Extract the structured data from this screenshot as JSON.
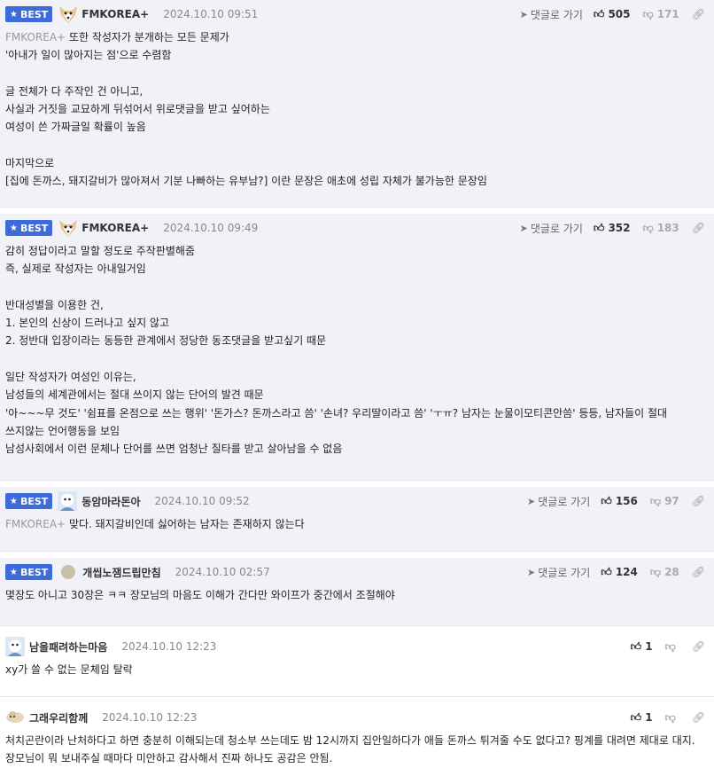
{
  "ui": {
    "reply_label": "댓글로 가기",
    "best_label": "BEST",
    "accent": "#3d6bd7"
  },
  "comments": [
    {
      "nick": "FMKOREA+",
      "date": "2024.10.10 09:51",
      "up": "505",
      "down": "171",
      "lines": [
        {
          "ref": "FMKOREA+",
          "text": "또한 작성자가 분개하는 모든 문제가"
        },
        {
          "ref": "",
          "text": "'아내가 일이 많아지는 점'으로 수렴함"
        },
        {
          "ref": "",
          "text": ""
        },
        {
          "ref": "",
          "text": "글 전체가 다 주작인 건 아니고,"
        },
        {
          "ref": "",
          "text": "사실과 거짓을 교묘하게 뒤섞어서 위로댓글을 받고 싶어하는"
        },
        {
          "ref": "",
          "text": "여성이 쓴 가짜글일 확률이 높음"
        },
        {
          "ref": "",
          "text": ""
        },
        {
          "ref": "",
          "text": "마지막으로"
        },
        {
          "ref": "",
          "text": "[집에 돈까스, 돼지갈비가 많아져서 기분 나빠하는 유부남?] 이란 문장은 애초에 성립 자체가 불가능한 문장임"
        }
      ]
    },
    {
      "nick": "FMKOREA+",
      "date": "2024.10.10 09:49",
      "up": "352",
      "down": "183",
      "lines": [
        {
          "ref": "",
          "text": "감히 정답이라고 말할 정도로 주작판별해줌"
        },
        {
          "ref": "",
          "text": "즉, 실제로 작성자는 아내일거임"
        },
        {
          "ref": "",
          "text": ""
        },
        {
          "ref": "",
          "text": "반대성별을 이용한 건,"
        },
        {
          "ref": "",
          "text": "1. 본인의 신상이 드러나고 싶지 않고"
        },
        {
          "ref": "",
          "text": "2. 정반대 입장이라는 동등한 관계에서 정당한 동조댓글을 받고싶기 때문"
        },
        {
          "ref": "",
          "text": ""
        },
        {
          "ref": "",
          "text": "일단 작성자가 여성인 이유는,"
        },
        {
          "ref": "",
          "text": "남성들의 세계관에서는 절대 쓰이지 않는 단어의 발견 때문"
        },
        {
          "ref": "",
          "text": "'아~~~무 것도' '쉼표를 온점으로 쓰는 행위' '돈가스? 돈까스라고 씀' '손녀? 우리딸이라고 씀' 'ㅜㅠ? 남자는 눈물이모티콘안씀' 등등, 남자들이 절대 쓰지않는 언어행동을 보임"
        },
        {
          "ref": "",
          "text": "남성사회에서 이런 문체나 단어를 쓰면 엄청난 질타를 받고 살아남을 수 없음"
        }
      ]
    },
    {
      "nick": "동암마라돈아",
      "date": "2024.10.10 09:52",
      "up": "156",
      "down": "97",
      "lines": [
        {
          "ref": "FMKOREA+",
          "text": "맞다. 돼지갈비인데 싫어하는 남자는 존재하지 않는다"
        }
      ]
    },
    {
      "nick": "개씹노잼드립만침",
      "date": "2024.10.10 02:57",
      "up": "124",
      "down": "28",
      "lines": [
        {
          "ref": "",
          "text": "몇장도 아니고 30장은 ㅋㅋ 장모님의 마음도 이해가 간다만 와이프가 중간에서 조절해야"
        }
      ]
    },
    {
      "nick": "남을패려하는마음",
      "date": "2024.10.10 12:23",
      "up": "1",
      "down": "",
      "lines": [
        {
          "ref": "",
          "text": "xy가 쓸 수 없는 문체임 탈락"
        }
      ]
    },
    {
      "nick": "그래우리함께",
      "date": "2024.10.10 12:23",
      "up": "1",
      "down": "",
      "lines": [
        {
          "ref": "",
          "text": "처치곤란이라 난처하다고 하면 충분히 이해되는데 청소부 쓰는데도 밤 12시까지 집안일하다가 애들 돈까스 튀겨줄 수도 없다고? 핑계를 대려면 제대로 대지. 장모님이 뭐 보내주실 때마다 미안하고 감사해서 진짜 하나도 공감은 안됨."
        }
      ]
    }
  ]
}
